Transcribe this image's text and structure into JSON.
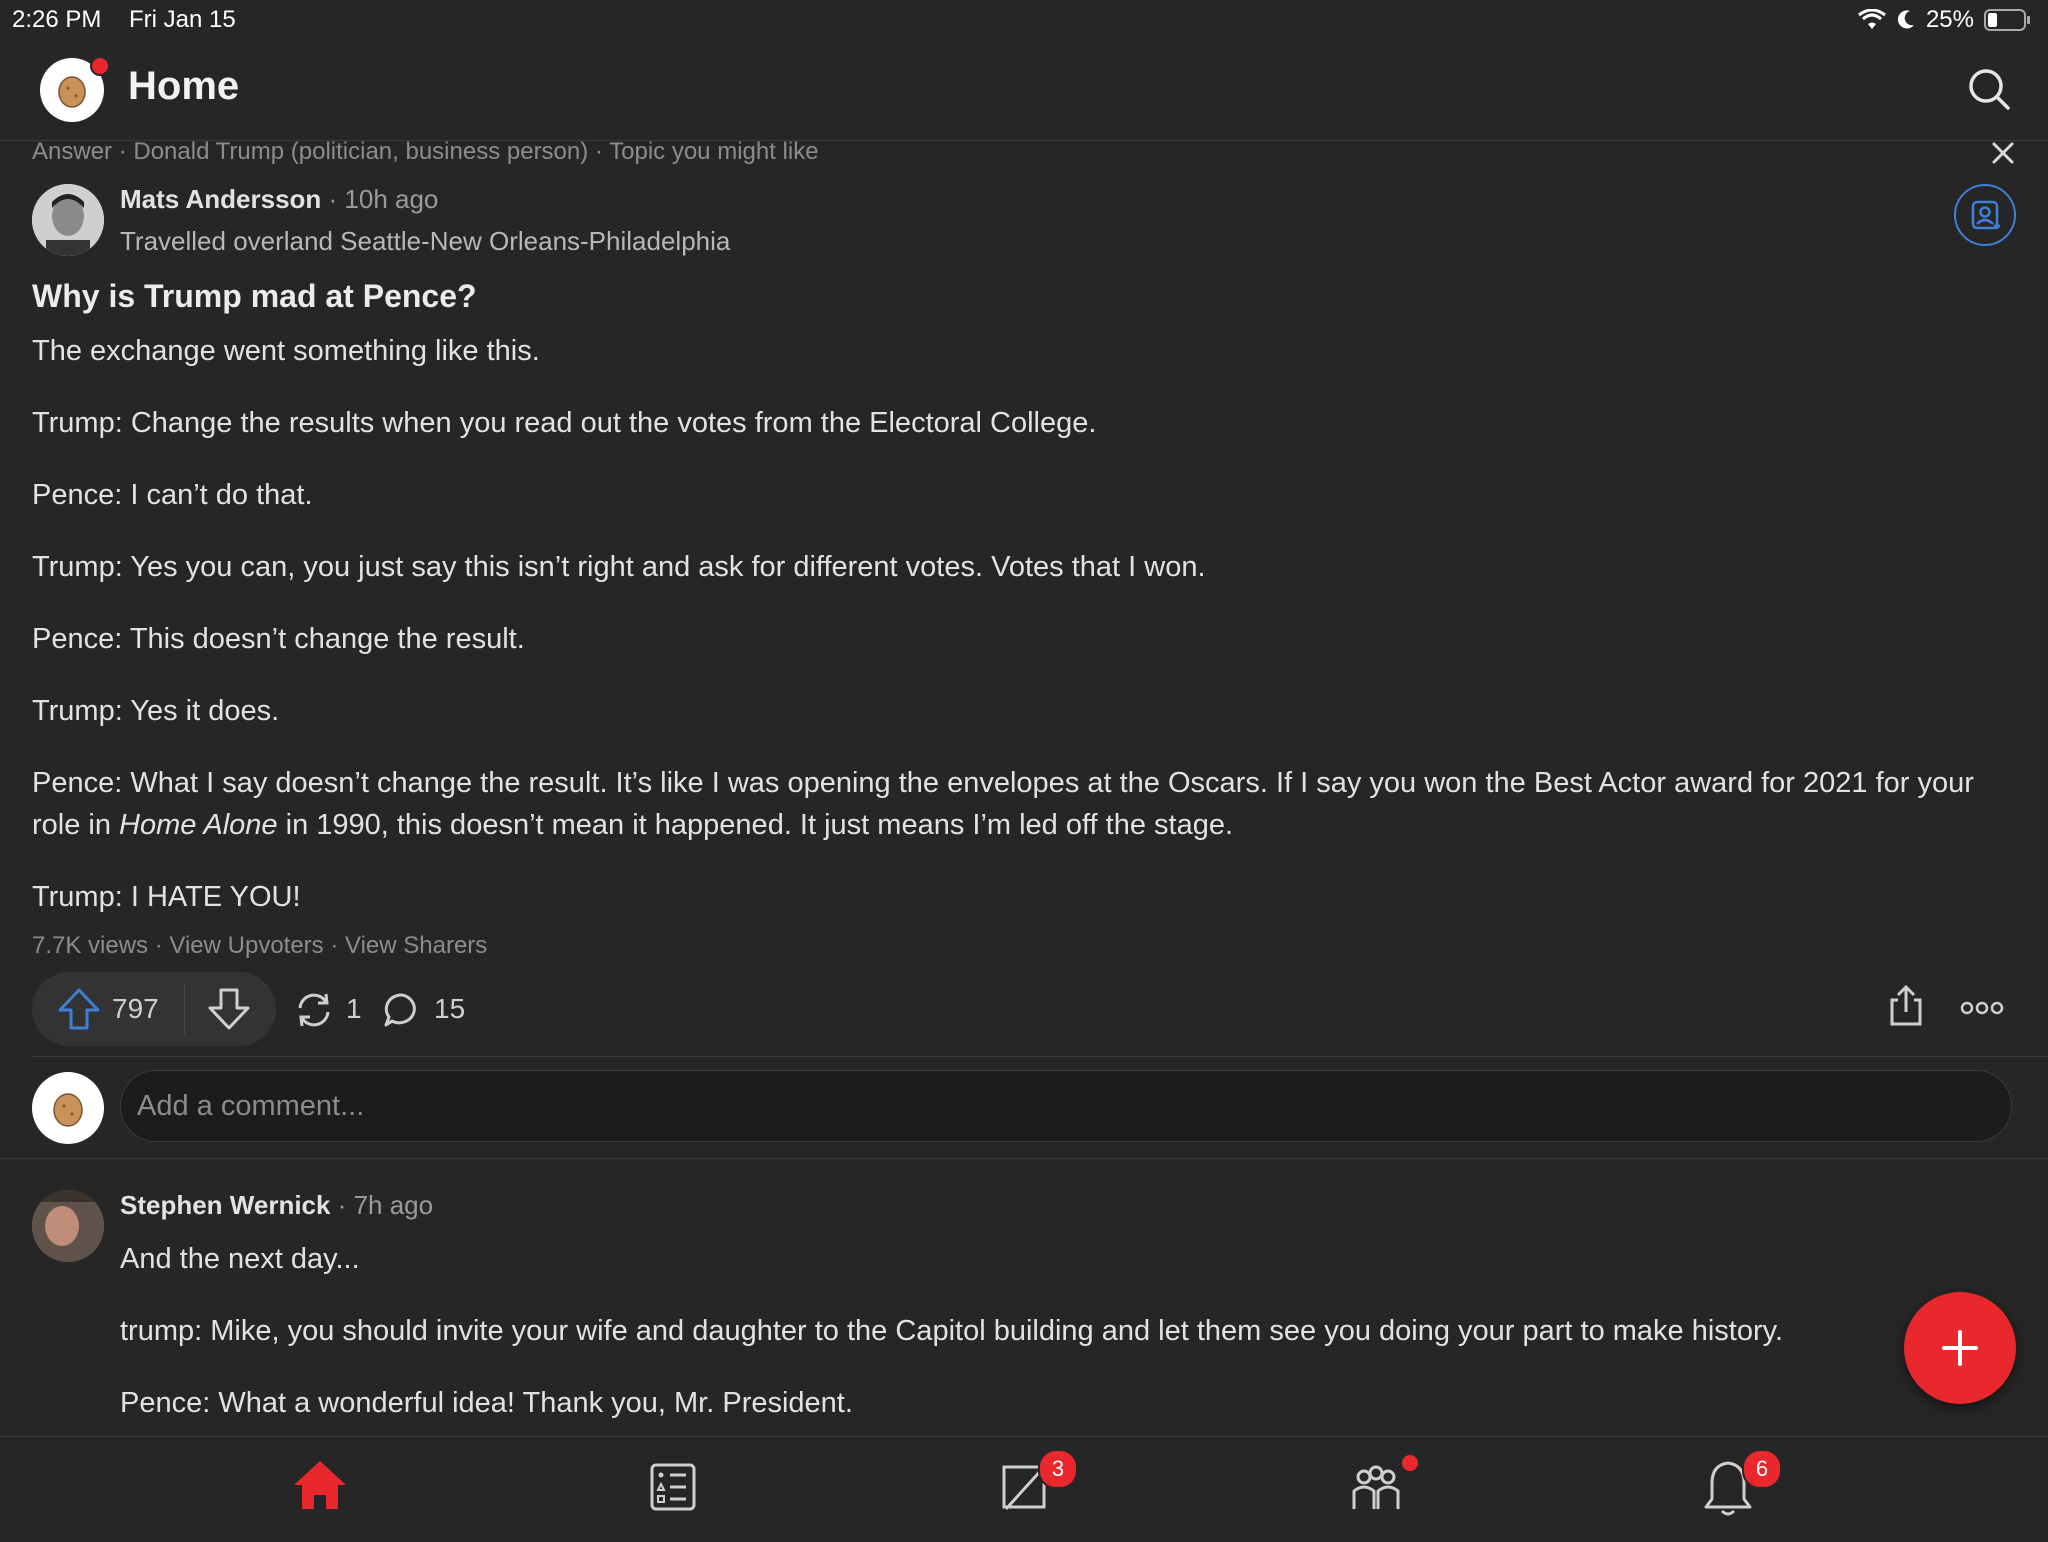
{
  "status_bar": {
    "time": "2:26 PM",
    "date": "Fri Jan 15",
    "battery": "25%",
    "icons": [
      "wifi-icon",
      "moon-icon",
      "battery-icon"
    ]
  },
  "header": {
    "title": "Home"
  },
  "post": {
    "meta": "Answer · Donald Trump (politician, business person) · Topic you might like",
    "author": "Mats Andersson",
    "time": " · 10h ago",
    "credential": "Travelled overland Seattle-New Orleans-Philadelphia",
    "question": "Why is Trump mad at Pence?",
    "paragraphs": {
      "p1": "The exchange went something like this.",
      "p2": "Trump: Change the results when you read out the votes from the Electoral College.",
      "p3": "Pence: I can’t do that.",
      "p4": "Trump: Yes you can, you just say this isn’t right and ask for different votes. Votes that I won.",
      "p5": "Pence: This doesn’t change the result.",
      "p6": "Trump: Yes it does.",
      "p7a": "Pence: What I say doesn’t change the result. It’s like I was opening the envelopes at the Oscars. If I say you won the Best Actor award for 2021 for your role in ",
      "p7em": "Home Alone",
      "p7b": " in 1990, this doesn’t mean it happened. It just means I’m led off the stage.",
      "p8": "Trump: I HATE YOU!"
    },
    "stats": "7.7K views · View Upvoters · View Sharers",
    "upvotes": "797",
    "shares": "1",
    "comments": "15"
  },
  "comment_input": {
    "placeholder": "Add a comment..."
  },
  "comment": {
    "author": "Stephen Wernick",
    "time": " · 7h ago",
    "p1": "And the next day...",
    "p2": "trump: Mike, you should invite your wife and daughter to the Capitol building and let them see you doing your part to make history.",
    "p3": "Pence: What a wonderful idea! Thank you, Mr. President."
  },
  "tabbar": {
    "write_badge": "3",
    "notifications_badge": "6"
  },
  "colors": {
    "accent": "#e8282d",
    "link_blue": "#3f7fd8",
    "background": "#262626"
  }
}
